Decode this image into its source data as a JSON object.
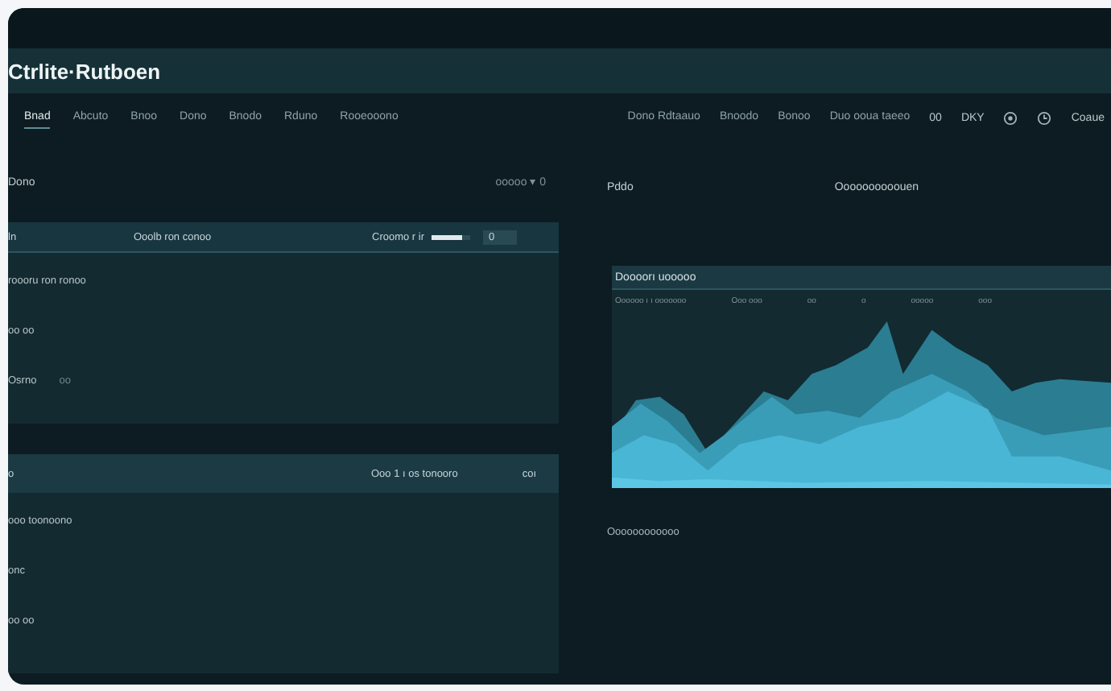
{
  "title": "Ctrlite·Rutboen",
  "nav_left": [
    {
      "label": "Bnad",
      "selected": true
    },
    {
      "label": "Abcuto",
      "selected": false
    },
    {
      "label": "Bnoo",
      "selected": false
    },
    {
      "label": "Dono",
      "selected": false
    },
    {
      "label": "Bnodo",
      "selected": false
    },
    {
      "label": "Rduno",
      "selected": false
    },
    {
      "label": "Rooeooono",
      "selected": false
    }
  ],
  "nav_right": [
    "Dono Rdtaauo",
    "Bnoodo",
    "Bonoo",
    "Duo ooua taeeo"
  ],
  "toolbar": {
    "badge": "00",
    "menu": "DKY",
    "user": "Coaue"
  },
  "left_section": {
    "label": "Dono",
    "filter": "ooooo ▾ 0"
  },
  "card_1": {
    "header": [
      "ln",
      "Ooolb ron conoo",
      "Croomo r ir"
    ],
    "slider": {
      "level": 0.8
    },
    "counter": "0",
    "rows": [
      {
        "label": "roooru ron ronoo"
      },
      {
        "label": "oo oo"
      },
      {
        "label": "Osrno",
        "value": "oo"
      }
    ]
  },
  "card_2": {
    "header": [
      "o",
      "Ooo 1 ı os tonooro",
      "coı"
    ],
    "rows": [
      {
        "label": "ooo toonoono"
      },
      {
        "label": "onc"
      },
      {
        "label": "oo oo"
      }
    ]
  },
  "right_section": {
    "label": "Pddo",
    "caption": "Oooooooooouen"
  },
  "chart_card": {
    "title": "Doooorı uooooo",
    "columns": [
      "Oooooo ı ı ooooooo",
      "Ooo ooo",
      "oo",
      "o",
      "ooooo",
      "ooo"
    ]
  },
  "footer_note": "Oooooooooooo"
}
